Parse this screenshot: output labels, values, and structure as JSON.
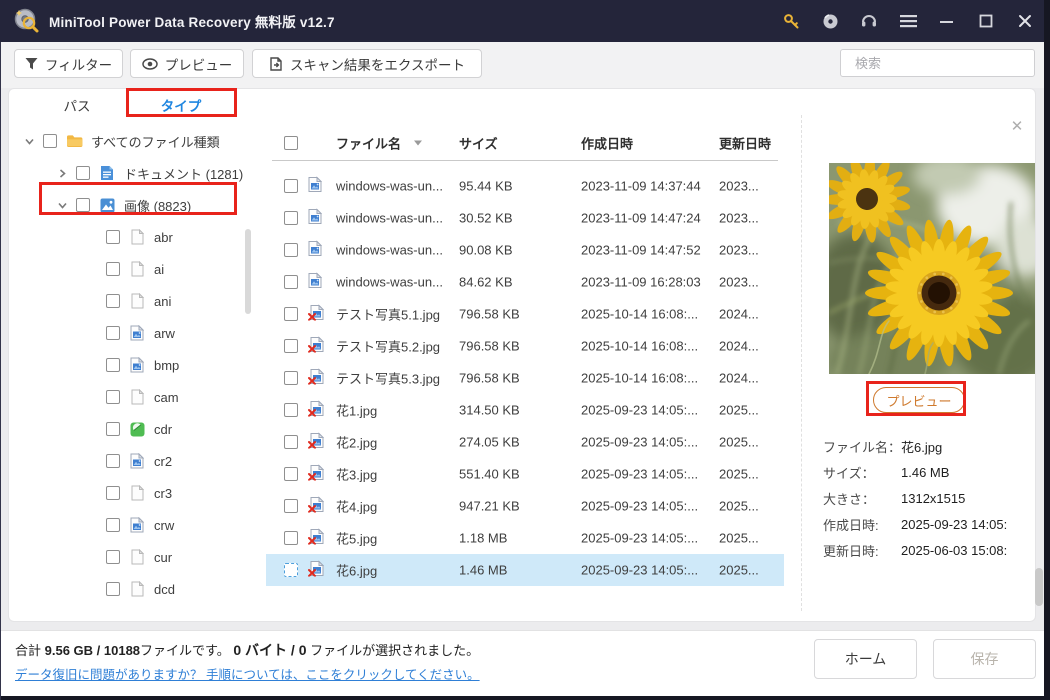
{
  "window": {
    "title": "MiniTool Power Data Recovery 無料版 v12.7",
    "titlebar_icons": [
      "key-icon",
      "disc-icon",
      "headset-icon",
      "menu-icon",
      "minimize-icon",
      "maximize-icon",
      "close-icon"
    ]
  },
  "toolbar": {
    "filter_label": "フィルター",
    "preview_label": "プレビュー",
    "export_label": "スキャン結果をエクスポート",
    "search_placeholder": "検索"
  },
  "sidebar": {
    "tabs": [
      {
        "label": "パス",
        "active": false
      },
      {
        "label": "タイプ",
        "active": true,
        "annotated": true
      }
    ],
    "tree": [
      {
        "label": "すべてのファイル種類",
        "level": 0,
        "icon": "folder-icon",
        "expander": "down"
      },
      {
        "label": "ドキュメント (1281)",
        "level": 1,
        "icon": "document-icon",
        "expander": "right"
      },
      {
        "label": "画像 (8823)",
        "level": 1,
        "icon": "image-type-icon",
        "expander": "down",
        "annotated": true
      },
      {
        "label": "abr",
        "level": 2,
        "icon": "generic-file-icon"
      },
      {
        "label": "ai",
        "level": 2,
        "icon": "generic-file-icon"
      },
      {
        "label": "ani",
        "level": 2,
        "icon": "generic-file-icon"
      },
      {
        "label": "arw",
        "level": 2,
        "icon": "image-file-icon"
      },
      {
        "label": "bmp",
        "level": 2,
        "icon": "image-file-icon"
      },
      {
        "label": "cam",
        "level": 2,
        "icon": "generic-file-icon"
      },
      {
        "label": "cdr",
        "level": 2,
        "icon": "cdr-file-icon"
      },
      {
        "label": "cr2",
        "level": 2,
        "icon": "image-file-icon"
      },
      {
        "label": "cr3",
        "level": 2,
        "icon": "generic-file-icon"
      },
      {
        "label": "crw",
        "level": 2,
        "icon": "image-file-icon"
      },
      {
        "label": "cur",
        "level": 2,
        "icon": "generic-file-icon"
      },
      {
        "label": "dcd",
        "level": 2,
        "icon": "generic-file-icon"
      }
    ]
  },
  "table": {
    "columns": [
      "ファイル名",
      "サイズ",
      "作成日時",
      "更新日時"
    ],
    "sorted_column": "ファイル名",
    "rows": [
      {
        "name": "windows-was-un...",
        "icon": "image-file-icon",
        "size": "95.44 KB",
        "created": "2023-11-09 14:37:44",
        "modified": "2023...",
        "selected": false
      },
      {
        "name": "windows-was-un...",
        "icon": "image-file-icon",
        "size": "30.52 KB",
        "created": "2023-11-09 14:47:24",
        "modified": "2023...",
        "selected": false
      },
      {
        "name": "windows-was-un...",
        "icon": "image-file-icon",
        "size": "90.08 KB",
        "created": "2023-11-09 14:47:52",
        "modified": "2023...",
        "selected": false
      },
      {
        "name": "windows-was-un...",
        "icon": "image-file-icon",
        "size": "84.62 KB",
        "created": "2023-11-09 16:28:03",
        "modified": "2023...",
        "selected": false
      },
      {
        "name": "テスト写真5.1.jpg",
        "icon": "deleted-image-file-icon",
        "size": "796.58 KB",
        "created": "2025-10-14 16:08:...",
        "modified": "2024...",
        "selected": false
      },
      {
        "name": "テスト写真5.2.jpg",
        "icon": "deleted-image-file-icon",
        "size": "796.58 KB",
        "created": "2025-10-14 16:08:...",
        "modified": "2024...",
        "selected": false
      },
      {
        "name": "テスト写真5.3.jpg",
        "icon": "deleted-image-file-icon",
        "size": "796.58 KB",
        "created": "2025-10-14 16:08:...",
        "modified": "2024...",
        "selected": false
      },
      {
        "name": "花1.jpg",
        "icon": "deleted-image-file-icon",
        "size": "314.50 KB",
        "created": "2025-09-23 14:05:...",
        "modified": "2025...",
        "selected": false
      },
      {
        "name": "花2.jpg",
        "icon": "deleted-image-file-icon",
        "size": "274.05 KB",
        "created": "2025-09-23 14:05:...",
        "modified": "2025...",
        "selected": false
      },
      {
        "name": "花3.jpg",
        "icon": "deleted-image-file-icon",
        "size": "551.40 KB",
        "created": "2025-09-23 14:05:...",
        "modified": "2025...",
        "selected": false
      },
      {
        "name": "花4.jpg",
        "icon": "deleted-image-file-icon",
        "size": "947.21 KB",
        "created": "2025-09-23 14:05:...",
        "modified": "2025...",
        "selected": false
      },
      {
        "name": "花5.jpg",
        "icon": "deleted-image-file-icon",
        "size": "1.18 MB",
        "created": "2025-09-23 14:05:...",
        "modified": "2025...",
        "selected": false
      },
      {
        "name": "花6.jpg",
        "icon": "deleted-image-file-icon",
        "size": "1.46 MB",
        "created": "2025-09-23 14:05:...",
        "modified": "2025...",
        "selected": true
      }
    ]
  },
  "preview": {
    "close_icon": "✕",
    "image_description": "yellow gerbera daisy photo",
    "button_label": "プレビュー",
    "info": [
      {
        "label": "ファイル名：",
        "value": "花6.jpg"
      },
      {
        "label": "サイズ：",
        "value": "1.46 MB"
      },
      {
        "label": "大きさ：",
        "value": "1312x1515"
      },
      {
        "label": "作成日時:",
        "value": "2025-09-23 14:05:"
      },
      {
        "label": "更新日時:",
        "value": "2025-06-03 15:08:"
      }
    ]
  },
  "statusbar": {
    "total_prefix": "合計 ",
    "total_bold": "9.56 GB / 10188",
    "total_suffix": "ファイルです。 ",
    "selected_bold": "0 バイト / 0",
    "selected_suffix": " ファイルが選択されました。",
    "help_link": "データ復旧に問題がありますか？ 手順については、ここをクリックしてください。",
    "home_button": "ホーム",
    "save_button": "保存"
  },
  "colors": {
    "titlebar": "#24253a",
    "annotation_red": "#e8231b",
    "tab_active_blue": "#1f86e0",
    "selection_blue": "#cfe9f9",
    "link_blue": "#2f7fd6",
    "key_yellow": "#eab437",
    "preview_button_orange": "#cf7a2e"
  }
}
